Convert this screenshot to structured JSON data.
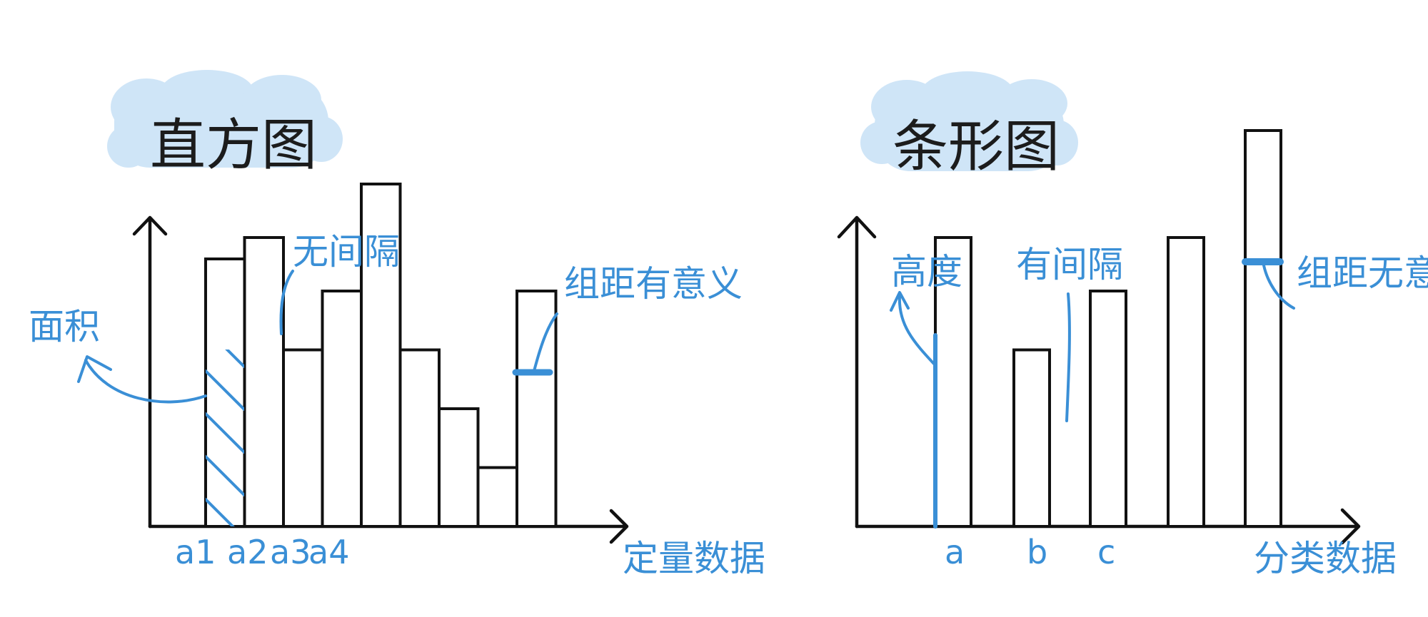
{
  "colors": {
    "ink": "#111111",
    "annotation": "#3a8fd6",
    "title_cloud": "#cfe5f7"
  },
  "histogram": {
    "title": "直方图",
    "annotations": {
      "area": "面积",
      "no_gap": "无间隔",
      "bin_width": "组距有意义"
    },
    "ticks": [
      "a1",
      "a2",
      "a3",
      "a4"
    ],
    "x_axis_label": "定量数据"
  },
  "bar_chart": {
    "title": "条形图",
    "annotations": {
      "height": "高度",
      "gap": "有间隔",
      "bin_width": "组距无意义"
    },
    "ticks": [
      "a",
      "b",
      "c"
    ],
    "x_axis_label": "分类数据"
  },
  "chart_data": [
    {
      "type": "bar",
      "values": [
        5,
        5.4,
        3.3,
        4.4,
        6.4,
        3.3,
        2.2,
        1.1,
        4.4
      ],
      "highlighted_bar_index": 1,
      "highlighted_top_index": 8,
      "gap": false
    },
    {
      "type": "bar",
      "values": [
        5.4,
        3.3,
        4.4,
        5.4,
        7.4
      ],
      "highlighted_side_index": 0,
      "highlighted_top_index": 4,
      "gap": true
    }
  ]
}
